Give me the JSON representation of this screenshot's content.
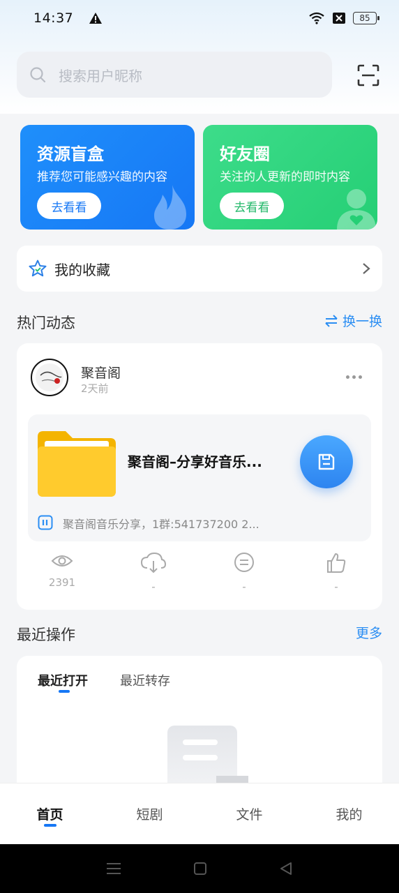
{
  "status_bar": {
    "time": "14:37",
    "battery": "85"
  },
  "search": {
    "placeholder": "搜索用户昵称"
  },
  "cards": [
    {
      "title": "资源盲盒",
      "subtitle": "推荐您可能感兴趣的内容",
      "button": "去看看"
    },
    {
      "title": "好友圈",
      "subtitle": "关注的人更新的即时内容",
      "button": "去看看"
    }
  ],
  "favorites": {
    "label": "我的收藏"
  },
  "hot": {
    "title": "热门动态",
    "refresh_label": "换一换",
    "post": {
      "author": "聚音阁",
      "time": "2天前",
      "file_title": "聚音阁–分享好音乐...",
      "file_desc": "聚音阁音乐分享，1群:541737200 2...",
      "stats": [
        "2391",
        "-",
        "-",
        "-"
      ]
    }
  },
  "recent": {
    "title": "最近操作",
    "more_label": "更多",
    "tabs": [
      "最近打开",
      "最近转存"
    ]
  },
  "bottom_nav": [
    "首页",
    "短剧",
    "文件",
    "我的"
  ],
  "colors": {
    "accent": "#1677f5",
    "blue_card": "#1f8ffb",
    "green_card": "#2dd67c"
  }
}
